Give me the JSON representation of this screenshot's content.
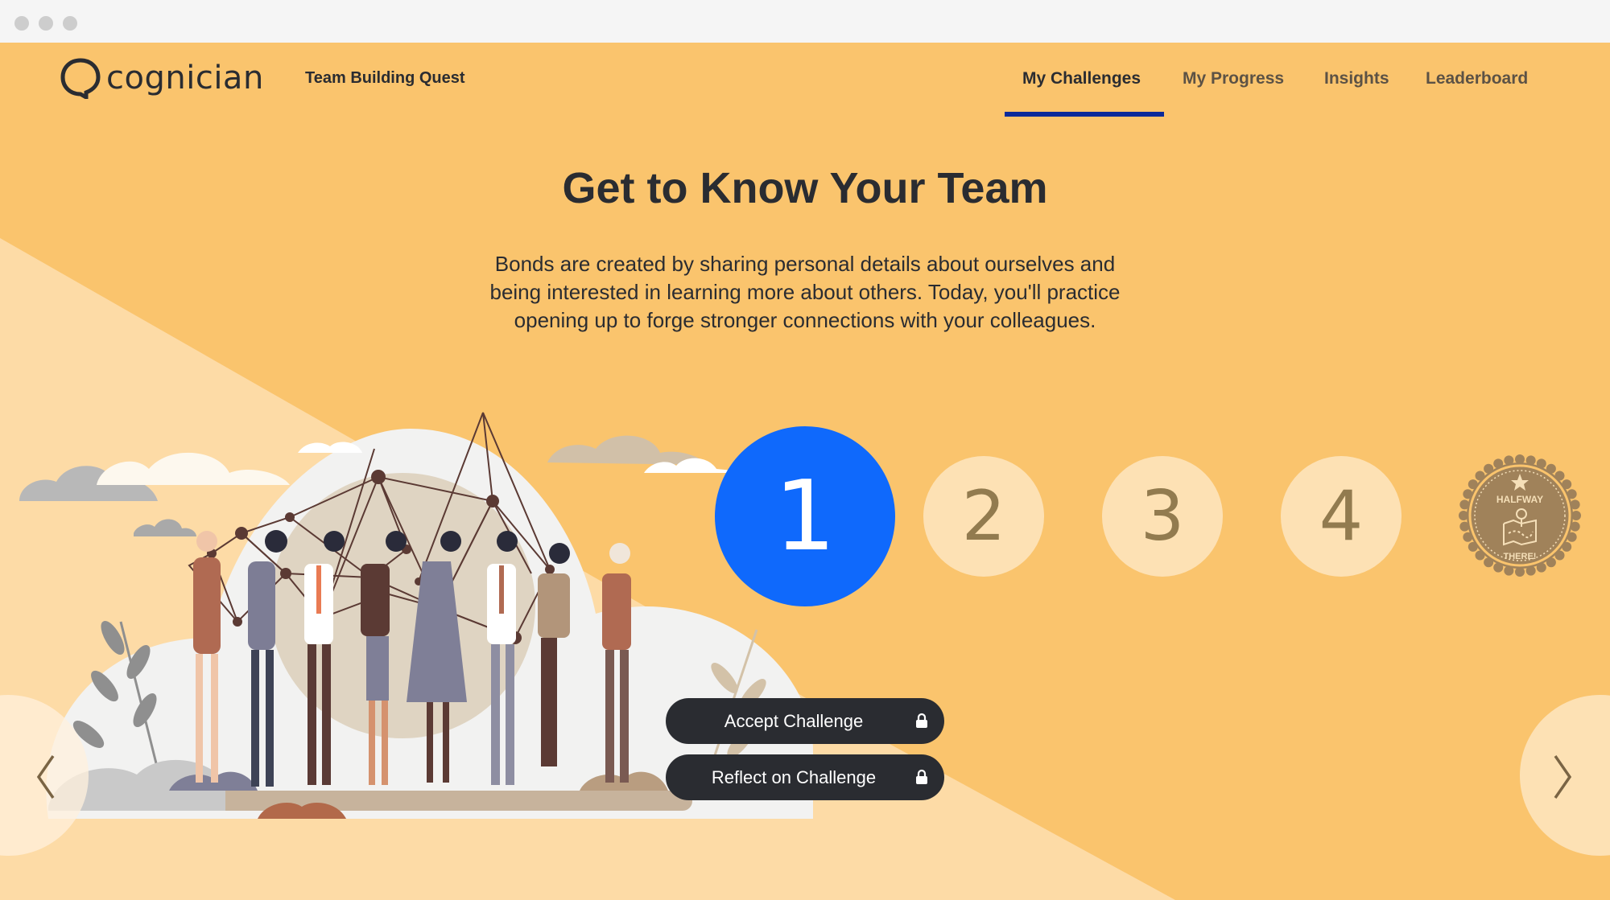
{
  "window": {
    "controls": [
      "close",
      "minimize",
      "maximize"
    ]
  },
  "header": {
    "logo_text": "cognician",
    "app_title": "Team Building Quest",
    "nav": [
      {
        "label": "My Challenges",
        "active": true
      },
      {
        "label": "My Progress",
        "active": false
      },
      {
        "label": "Insights",
        "active": false
      },
      {
        "label": "Leaderboard",
        "active": false
      }
    ]
  },
  "main": {
    "title": "Get to Know Your Team",
    "description": "Bonds are created by sharing personal details about ourselves and being interested in learning more about others. Today, you'll practice opening up to forge stronger connections with your colleagues.",
    "steps": [
      {
        "label": "1",
        "state": "active"
      },
      {
        "label": "2",
        "state": "inactive"
      },
      {
        "label": "3",
        "state": "inactive"
      },
      {
        "label": "4",
        "state": "inactive"
      }
    ],
    "badge": {
      "line1": "HALFWAY",
      "line2": "THERE!",
      "icon": "map-pin-icon"
    },
    "buttons": [
      {
        "label": "Accept Challenge",
        "icon": "lock-icon",
        "locked": true
      },
      {
        "label": "Reflect on Challenge",
        "icon": "lock-icon",
        "locked": true
      }
    ],
    "carousel": {
      "prev_icon": "chevron-left-icon",
      "next_icon": "chevron-right-icon"
    }
  },
  "colors": {
    "background": "#fac46d",
    "background_light": "#fddba6",
    "active_step": "#0f69fc",
    "inactive_step": "#fde1b4",
    "step_number": "#927b4f",
    "button": "#2a2c31",
    "nav_underline": "#0a2a9a",
    "badge": "#a0825a"
  }
}
